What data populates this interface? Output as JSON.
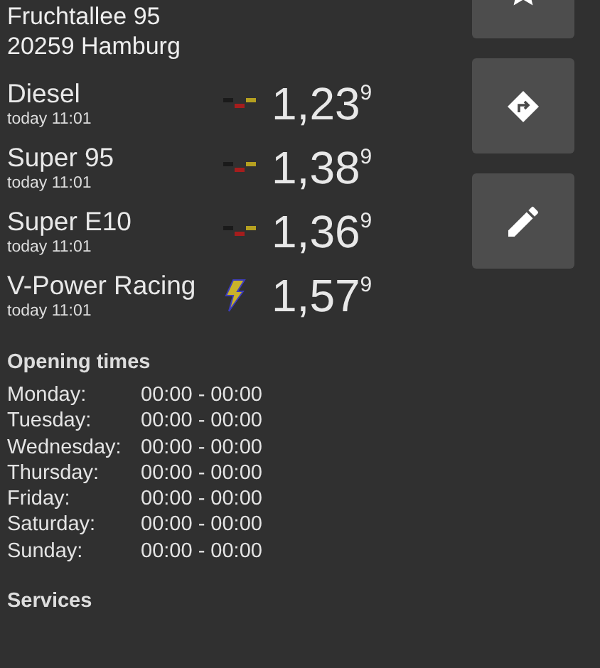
{
  "address": [
    "Fruchtallee 95",
    "20259 Hamburg"
  ],
  "actions": [
    {
      "kind": "star"
    },
    {
      "kind": "directions"
    },
    {
      "kind": "edit"
    }
  ],
  "prices": [
    {
      "name": "Diesel",
      "time": "today 11:01",
      "kind": "flag",
      "price": "1,23",
      "fraction": "9"
    },
    {
      "name": "Super 95",
      "time": "today 11:01",
      "kind": "flag",
      "price": "1,38",
      "fraction": "9"
    },
    {
      "name": "Super E10",
      "time": "today 11:01",
      "kind": "flag",
      "price": "1,36",
      "fraction": "9"
    },
    {
      "name": "V-Power Racing",
      "time": "today 11:01",
      "kind": "bolt",
      "price": "1,57",
      "fraction": "9"
    }
  ],
  "opening_times": {
    "title": "Opening times",
    "rows": [
      {
        "day": "Monday:",
        "hours": "00:00 - 00:00"
      },
      {
        "day": "Tuesday:",
        "hours": "00:00 - 00:00"
      },
      {
        "day": "Wednesday:",
        "hours": "00:00 - 00:00"
      },
      {
        "day": "Thursday:",
        "hours": "00:00 - 00:00"
      },
      {
        "day": "Friday:",
        "hours": "00:00 - 00:00"
      },
      {
        "day": "Saturday:",
        "hours": "00:00 - 00:00"
      },
      {
        "day": "Sunday:",
        "hours": "00:00 - 00:00"
      }
    ]
  },
  "services": {
    "title": "Services"
  }
}
